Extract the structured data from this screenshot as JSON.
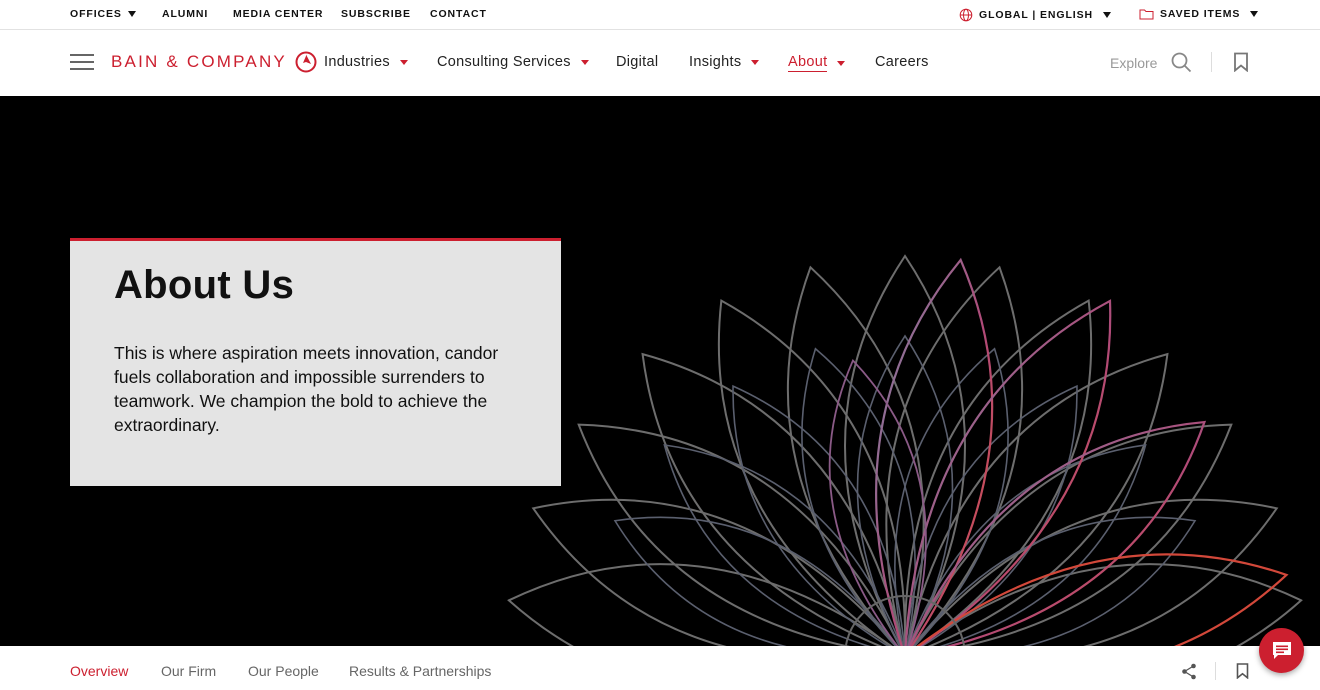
{
  "utility": {
    "offices": "OFFICES",
    "alumni": "ALUMNI",
    "media_center": "MEDIA CENTER",
    "subscribe": "SUBSCRIBE",
    "contact": "CONTACT",
    "region": "GLOBAL | ENGLISH",
    "saved_items": "SAVED ITEMS"
  },
  "brand": {
    "logo_text": "BAIN & COMPANY",
    "accent_color": "#cc1f2f"
  },
  "nav": {
    "items": [
      {
        "label": "Industries",
        "dropdown": true
      },
      {
        "label": "Consulting Services",
        "dropdown": true
      },
      {
        "label": "Digital",
        "dropdown": false
      },
      {
        "label": "Insights",
        "dropdown": true
      },
      {
        "label": "About",
        "dropdown": true,
        "active": true
      },
      {
        "label": "Careers",
        "dropdown": false
      }
    ],
    "explore": "Explore"
  },
  "hero": {
    "title": "About Us",
    "body": "This is where aspiration meets innovation, candor fuels collaboration and impossible surrenders to teamwork. We champion the bold to achieve the extraordinary."
  },
  "subnav": {
    "items": [
      {
        "label": "Overview",
        "active": true
      },
      {
        "label": "Our Firm"
      },
      {
        "label": "Our People"
      },
      {
        "label": "Results & Partnerships"
      }
    ]
  },
  "icons": {
    "menu": "hamburger-menu-icon",
    "search": "search-icon",
    "bookmark": "bookmark-icon",
    "globe": "globe-icon",
    "folder": "folder-icon",
    "share": "share-icon",
    "chat": "chat-icon"
  }
}
